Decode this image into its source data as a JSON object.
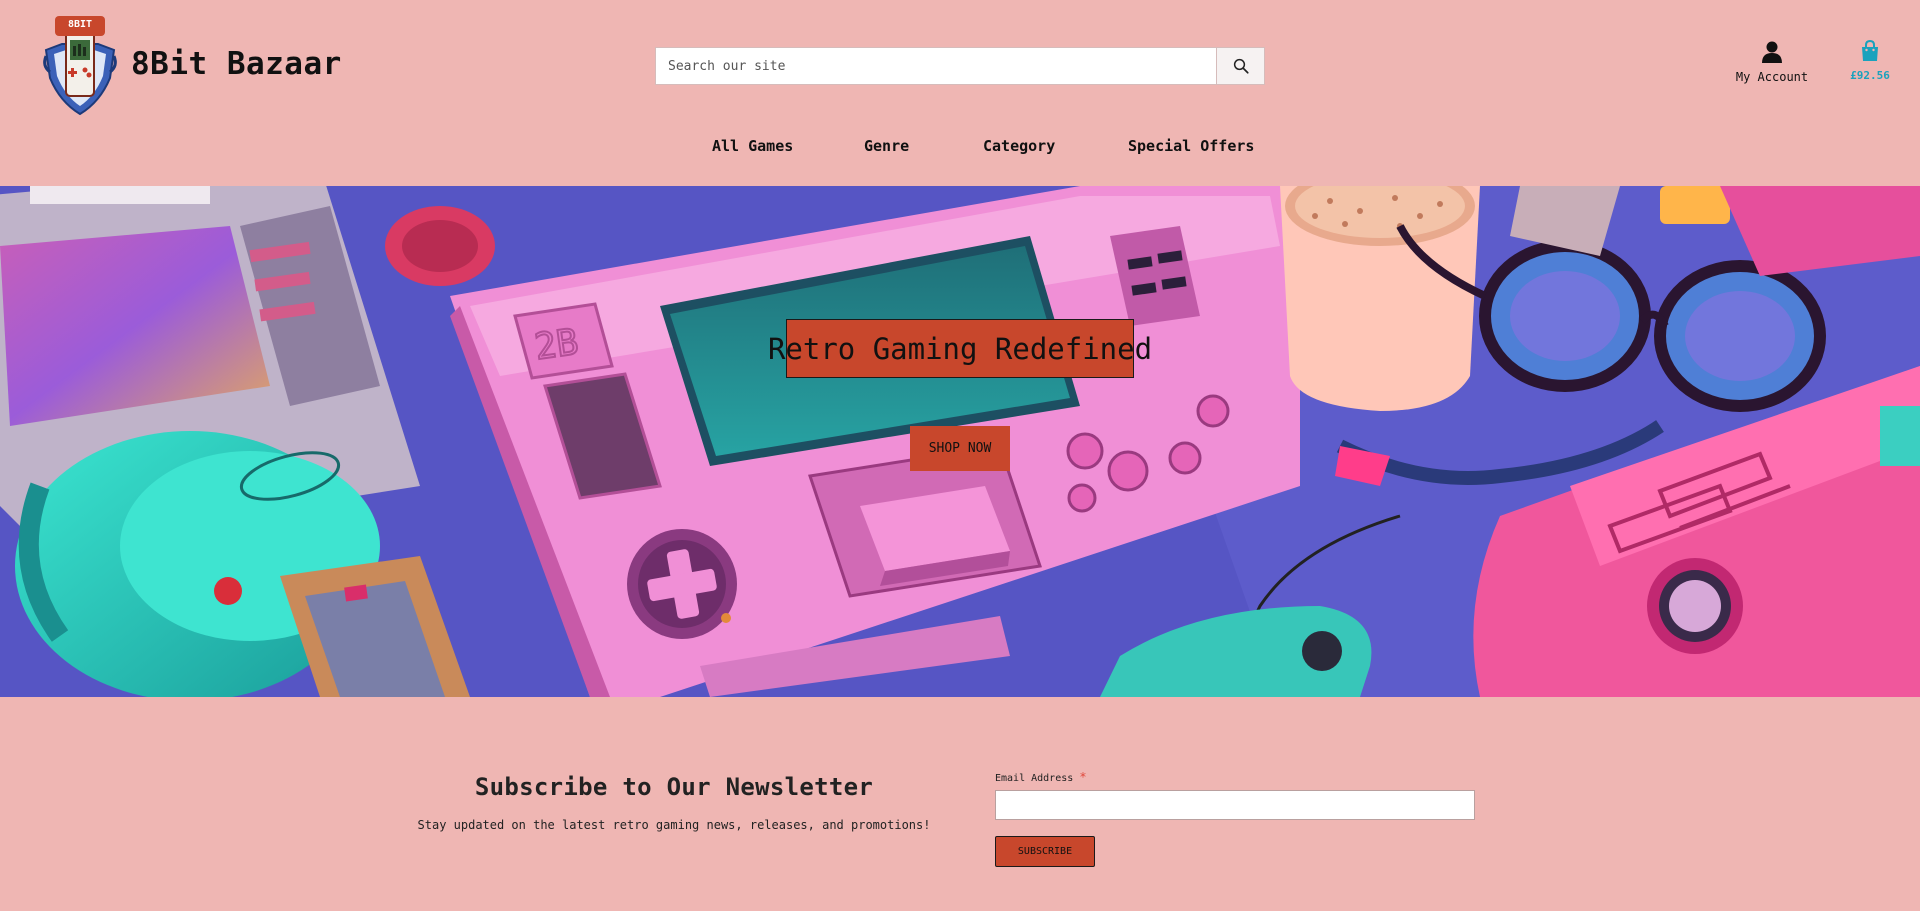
{
  "header": {
    "logo_badge": "8BIT",
    "brand": "8Bit Bazaar",
    "search": {
      "placeholder": "Search our site"
    },
    "account_label": "My Account",
    "cart_total": "£92.56"
  },
  "nav": {
    "items": [
      {
        "label": "All Games"
      },
      {
        "label": "Genre"
      },
      {
        "label": "Category"
      },
      {
        "label": "Special Offers"
      }
    ]
  },
  "hero": {
    "title": "Retro Gaming Redefined",
    "cta": "SHOP NOW",
    "console_badge": "2B"
  },
  "newsletter": {
    "title": "Subscribe to Our Newsletter",
    "subtitle": "Stay updated on the latest retro gaming news, releases, and promotions!",
    "email_label": "Email Address",
    "required_mark": "*",
    "button": "SUBSCRIBE"
  },
  "colors": {
    "background": "#efb6b3",
    "accent": "#c8472c",
    "cart": "#1aa2bd",
    "hero_pink": "#f08fd6",
    "hero_teal": "#2fd6c4",
    "hero_blue": "#5655c4"
  },
  "icons": [
    "logo",
    "search-icon",
    "user-icon",
    "shopping-bag-icon"
  ]
}
